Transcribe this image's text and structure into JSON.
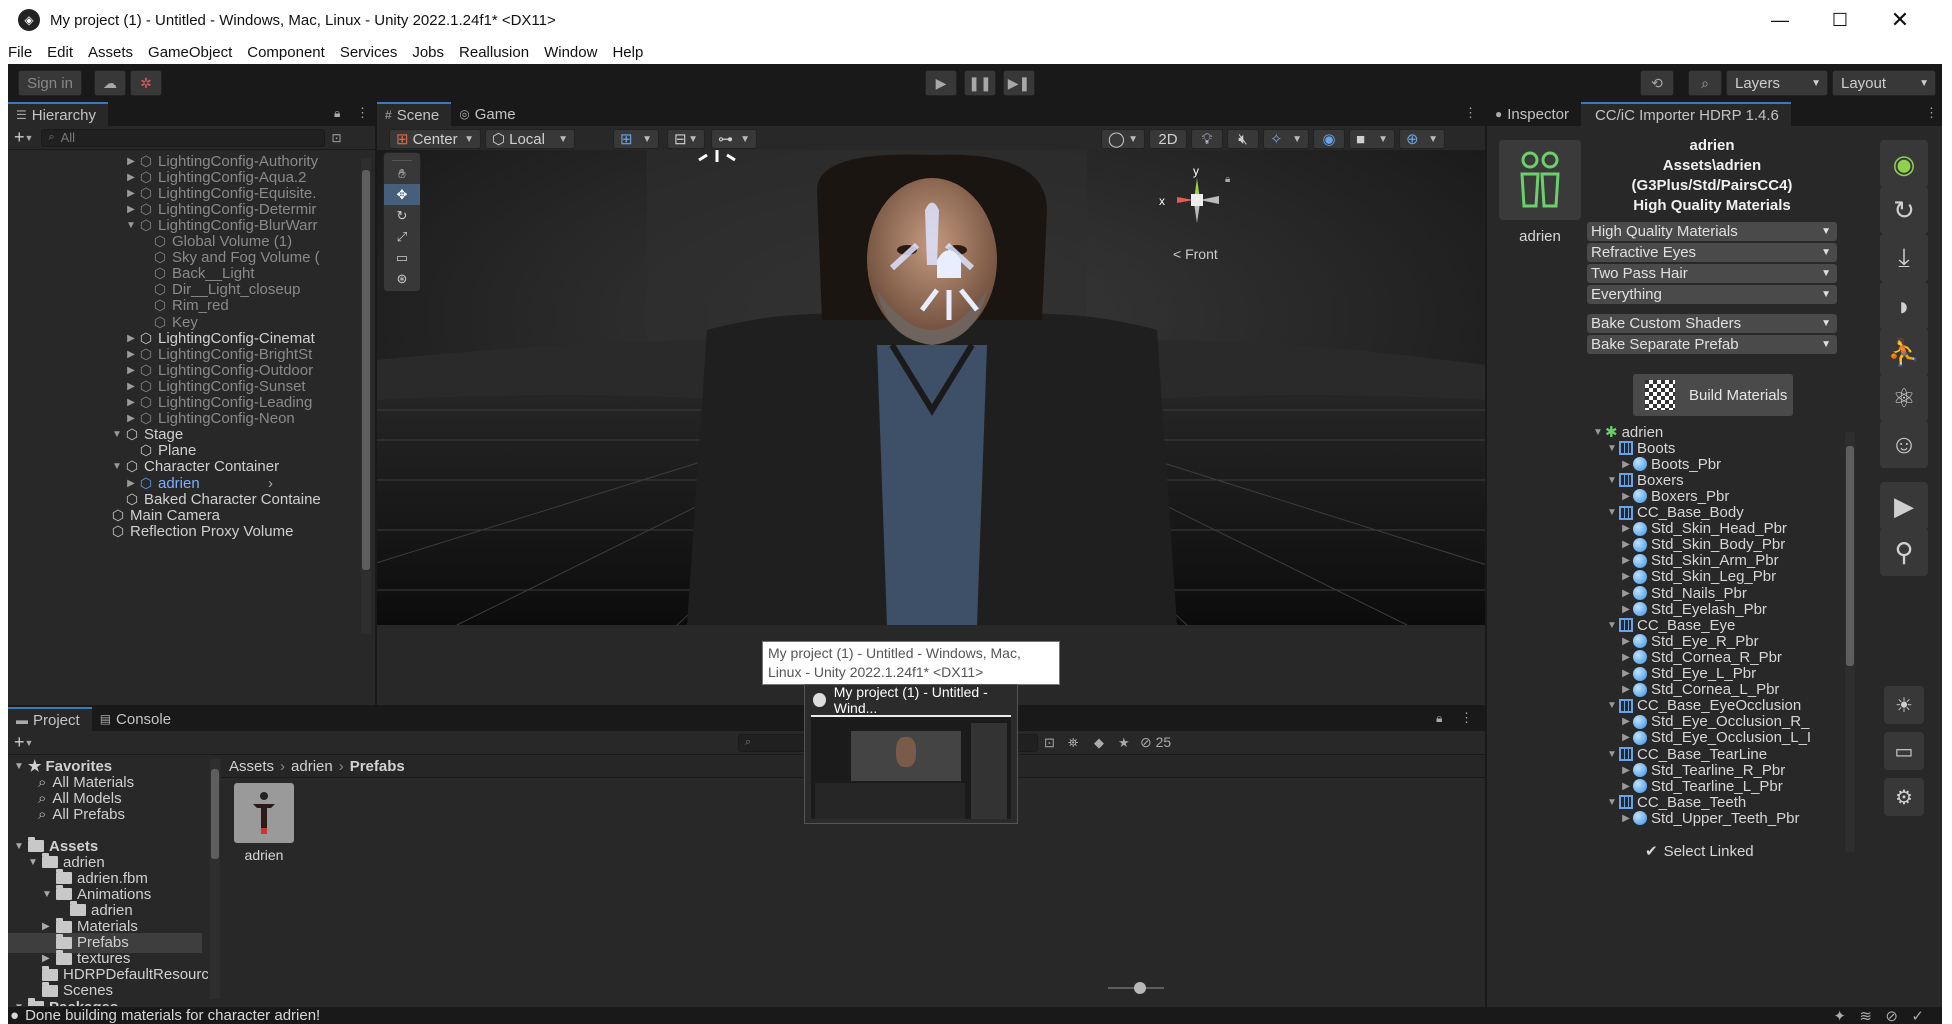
{
  "window": {
    "title": "My project (1) - Untitled - Windows, Mac, Linux - Unity 2022.1.24f1* <DX11>"
  },
  "menu": [
    "File",
    "Edit",
    "Assets",
    "GameObject",
    "Component",
    "Services",
    "Jobs",
    "Reallusion",
    "Window",
    "Help"
  ],
  "toolbar": {
    "sign_in": "Sign in",
    "layers": "Layers",
    "layout": "Layout"
  },
  "hierarchy": {
    "tab": "Hierarchy",
    "search_placeholder": "All",
    "items": [
      {
        "label": "LightingConfig-Authority",
        "dim": true,
        "expanded": false,
        "level": 1
      },
      {
        "label": "LightingConfig-Aqua.2",
        "dim": true,
        "expanded": false,
        "level": 1
      },
      {
        "label": "LightingConfig-Equisite.",
        "dim": true,
        "expanded": false,
        "level": 1
      },
      {
        "label": "LightingConfig-Determir",
        "dim": true,
        "expanded": false,
        "level": 1
      },
      {
        "label": "LightingConfig-BlurWarr",
        "dim": true,
        "expanded": true,
        "level": 1
      },
      {
        "label": "Global Volume (1)",
        "dim": true,
        "level": 2
      },
      {
        "label": "Sky and Fog Volume (",
        "dim": true,
        "level": 2
      },
      {
        "label": "Back__Light",
        "dim": true,
        "level": 2
      },
      {
        "label": "Dir__Light_closeup",
        "dim": true,
        "level": 2
      },
      {
        "label": "Rim_red",
        "dim": true,
        "level": 2
      },
      {
        "label": "Key",
        "dim": true,
        "level": 2
      },
      {
        "label": "LightingConfig-Cinemat",
        "dim": false,
        "expanded": false,
        "level": 1
      },
      {
        "label": "LightingConfig-BrightSt",
        "dim": true,
        "expanded": false,
        "level": 1
      },
      {
        "label": "LightingConfig-Outdoor",
        "dim": true,
        "expanded": false,
        "level": 1
      },
      {
        "label": "LightingConfig-Sunset",
        "dim": true,
        "expanded": false,
        "level": 1
      },
      {
        "label": "LightingConfig-Leading",
        "dim": true,
        "expanded": false,
        "level": 1
      },
      {
        "label": "LightingConfig-Neon",
        "dim": true,
        "expanded": false,
        "level": 1
      },
      {
        "label": "Stage",
        "dim": false,
        "expanded": true,
        "level": 0
      },
      {
        "label": "Plane",
        "dim": false,
        "level": 1
      },
      {
        "label": "Character Container",
        "dim": false,
        "expanded": true,
        "level": 0
      },
      {
        "label": "adrien",
        "dim": false,
        "blue": true,
        "expanded": false,
        "level": 1
      },
      {
        "label": "Baked Character Containe",
        "dim": false,
        "level": 0
      },
      {
        "label": "Main Camera",
        "dim": false,
        "level": -1
      },
      {
        "label": "Reflection Proxy Volume",
        "dim": false,
        "level": -1
      }
    ]
  },
  "scene": {
    "tabs": [
      "Scene",
      "Game"
    ],
    "pivot": "Center",
    "space": "Local",
    "mode_2d": "2D",
    "gizmo": {
      "y": "y",
      "x": "x",
      "front": "< Front"
    }
  },
  "inspector": {
    "tabs": [
      "Inspector",
      "CC/iC Importer HDRP 1.4.6"
    ],
    "avatar_name": "adrien",
    "header": [
      "adrien",
      "Assets\\adrien",
      "(G3Plus/Std/PairsCC4)",
      "High Quality Materials"
    ],
    "dropdowns": [
      "High Quality Materials",
      "Refractive Eyes",
      "Two Pass Hair",
      "Everything"
    ],
    "dropdowns2": [
      "Bake Custom Shaders",
      "Bake Separate Prefab"
    ],
    "build_button": "Build Materials",
    "select_linked": "Select Linked",
    "materials": [
      {
        "label": "adrien",
        "type": "root",
        "level": 0
      },
      {
        "label": "Boots",
        "type": "mesh",
        "level": 1
      },
      {
        "label": "Boots_Pbr",
        "type": "mat",
        "level": 2
      },
      {
        "label": "Boxers",
        "type": "mesh",
        "level": 1
      },
      {
        "label": "Boxers_Pbr",
        "type": "mat",
        "level": 2
      },
      {
        "label": "CC_Base_Body",
        "type": "mesh",
        "level": 1
      },
      {
        "label": "Std_Skin_Head_Pbr",
        "type": "mat",
        "level": 2
      },
      {
        "label": "Std_Skin_Body_Pbr",
        "type": "mat",
        "level": 2
      },
      {
        "label": "Std_Skin_Arm_Pbr",
        "type": "mat",
        "level": 2
      },
      {
        "label": "Std_Skin_Leg_Pbr",
        "type": "mat",
        "level": 2
      },
      {
        "label": "Std_Nails_Pbr",
        "type": "mat",
        "level": 2
      },
      {
        "label": "Std_Eyelash_Pbr",
        "type": "mat",
        "level": 2
      },
      {
        "label": "CC_Base_Eye",
        "type": "mesh",
        "level": 1
      },
      {
        "label": "Std_Eye_R_Pbr",
        "type": "mat",
        "level": 2
      },
      {
        "label": "Std_Cornea_R_Pbr",
        "type": "mat",
        "level": 2
      },
      {
        "label": "Std_Eye_L_Pbr",
        "type": "mat",
        "level": 2
      },
      {
        "label": "Std_Cornea_L_Pbr",
        "type": "mat",
        "level": 2
      },
      {
        "label": "CC_Base_EyeOcclusion",
        "type": "mesh",
        "level": 1
      },
      {
        "label": "Std_Eye_Occlusion_R_",
        "type": "mat",
        "level": 2
      },
      {
        "label": "Std_Eye_Occlusion_L_I",
        "type": "mat",
        "level": 2
      },
      {
        "label": "CC_Base_TearLine",
        "type": "mesh",
        "level": 1
      },
      {
        "label": "Std_Tearline_R_Pbr",
        "type": "mat",
        "level": 2
      },
      {
        "label": "Std_Tearline_L_Pbr",
        "type": "mat",
        "level": 2
      },
      {
        "label": "CC_Base_Teeth",
        "type": "mesh",
        "level": 1
      },
      {
        "label": "Std_Upper_Teeth_Pbr",
        "type": "mat",
        "level": 2
      }
    ]
  },
  "project": {
    "tabs": [
      "Project",
      "Console"
    ],
    "breadcrumb": [
      "Assets",
      "adrien",
      "Prefabs"
    ],
    "hidden_count": "25",
    "favorites_label": "Favorites",
    "favorites": [
      "All Materials",
      "All Models",
      "All Prefabs"
    ],
    "tree": [
      {
        "label": "Assets",
        "level": 0,
        "bold": true,
        "expanded": true
      },
      {
        "label": "adrien",
        "level": 1,
        "expanded": true
      },
      {
        "label": "adrien.fbm",
        "level": 2
      },
      {
        "label": "Animations",
        "level": 2,
        "expanded": true
      },
      {
        "label": "adrien",
        "level": 3
      },
      {
        "label": "Materials",
        "level": 2,
        "expanded": false
      },
      {
        "label": "Prefabs",
        "level": 2,
        "selected": true
      },
      {
        "label": "textures",
        "level": 2,
        "expanded": false
      },
      {
        "label": "HDRPDefaultResources",
        "level": 1
      },
      {
        "label": "Scenes",
        "level": 1
      },
      {
        "label": "Packages",
        "level": 0,
        "bold": true,
        "expanded": true
      }
    ],
    "asset": "adrien"
  },
  "taskbar_preview": {
    "tooltip": "My project (1) - Untitled - Windows, Mac, Linux - Unity 2022.1.24f1* <DX11>",
    "title": "My project (1) - Untitled - Wind..."
  },
  "status": {
    "message": "Done building materials for character adrien!"
  }
}
